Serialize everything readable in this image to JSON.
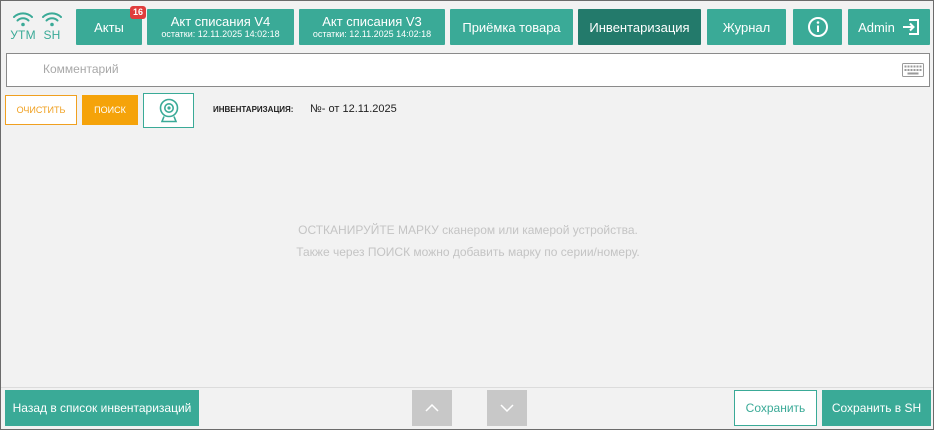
{
  "status": {
    "utm_label": "УТМ",
    "sh_label": "SH"
  },
  "nav": {
    "acts": {
      "label": "Акты",
      "badge": "16"
    },
    "act_v4": {
      "label": "Акт списания V4",
      "sub": "остатки: 12.11.2025 14:02:18"
    },
    "act_v3": {
      "label": "Акт списания V3",
      "sub": "остатки: 12.11.2025 14:02:18"
    },
    "receipt": {
      "label": "Приёмка товара"
    },
    "inventory": {
      "label": "Инвентаризация"
    },
    "journal": {
      "label": "Журнал"
    },
    "admin": {
      "label": "Admin"
    }
  },
  "comment": {
    "placeholder": "Комментарий",
    "value": ""
  },
  "toolbar": {
    "clear_label": "ОЧИСТИТЬ",
    "search_label": "ПОИСК"
  },
  "inventory_info": {
    "label": "ИНВЕНТАРИЗАЦИЯ:",
    "value": "№- от 12.11.2025"
  },
  "hint": {
    "line1": "ОСТКАНИРУЙТЕ МАРКУ сканером или камерой устройства.",
    "line2": "Также через ПОИСК можно добавить марку по серии/номеру."
  },
  "footer": {
    "back_label": "Назад в список инвентаризаций",
    "save_label": "Сохранить",
    "save_sh_label": "Сохранить в SH"
  },
  "colors": {
    "accent": "#3aaa97",
    "active": "#237a6b",
    "orange": "#f5a30a",
    "badge": "#e03c3c"
  }
}
